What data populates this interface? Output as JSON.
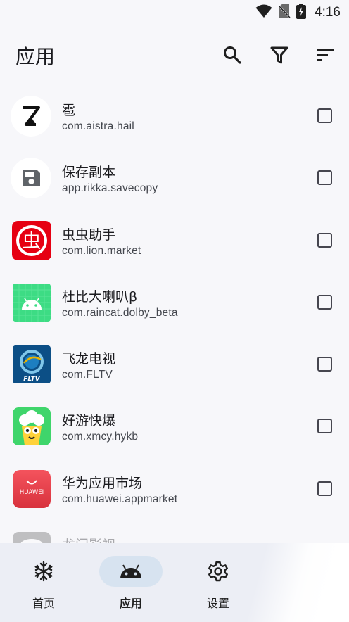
{
  "status_bar": {
    "time": "4:16",
    "icons": [
      "wifi-icon",
      "no-sim-icon",
      "battery-charging-icon"
    ]
  },
  "appbar": {
    "title": "应用",
    "actions": [
      "search-icon",
      "filter-icon",
      "sort-icon"
    ]
  },
  "apps": [
    {
      "label": "雹",
      "package": "com.aistra.hail",
      "icon": "hail-logo-icon",
      "checked": false
    },
    {
      "label": "保存副本",
      "package": "app.rikka.savecopy",
      "icon": "save-copy-icon",
      "checked": false
    },
    {
      "label": "虫虫助手",
      "package": "com.lion.market",
      "icon": "chongchong-icon",
      "checked": false
    },
    {
      "label": "杜比大喇叭β",
      "package": "com.raincat.dolby_beta",
      "icon": "android-default-icon",
      "checked": false
    },
    {
      "label": "飞龙电视",
      "package": "com.FLTV",
      "icon": "fltv-icon",
      "checked": false
    },
    {
      "label": "好游快爆",
      "package": "com.xmcy.hykb",
      "icon": "hykb-popcorn-icon",
      "checked": false
    },
    {
      "label": "华为应用市场",
      "package": "com.huawei.appmarket",
      "icon": "huawei-appgallery-icon",
      "checked": false
    },
    {
      "label": "龙门影视",
      "package": "",
      "icon": "longmen-icon",
      "checked": false
    }
  ],
  "icon_text": {
    "huawei": "HUAWEI",
    "fltv": "FLTV",
    "chongchong": "虫"
  },
  "bottom_nav": [
    {
      "label": "首页",
      "icon": "snowflake-icon",
      "active": false
    },
    {
      "label": "应用",
      "icon": "android-icon",
      "active": true
    },
    {
      "label": "设置",
      "icon": "gear-icon",
      "active": false
    }
  ],
  "colors": {
    "accent_pill": "#d7e3f0",
    "background": "#f7f7fa",
    "nav_background": "#eceef5"
  }
}
